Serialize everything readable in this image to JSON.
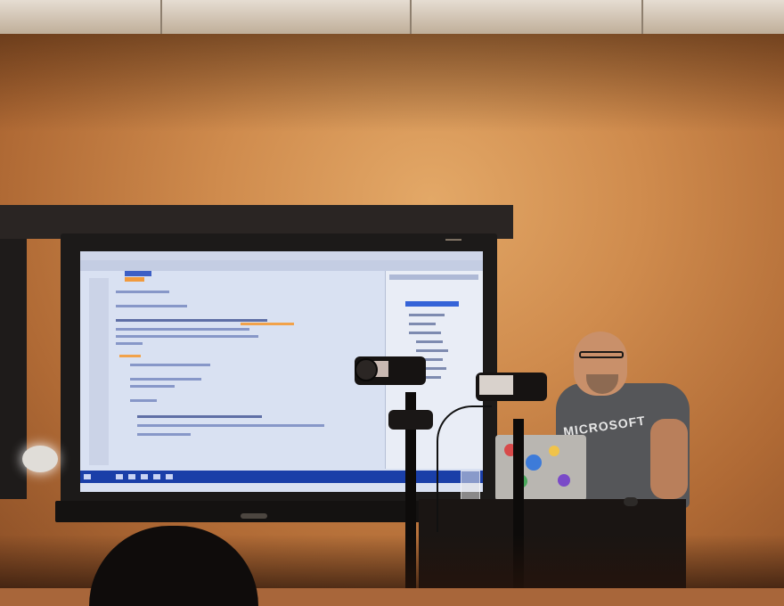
{
  "scene": {
    "description_type": "photo",
    "presenter_shirt_text": "MICROSOFT"
  },
  "colors": {
    "wall": "#cf8b4d",
    "screen_bg": "#d9e1f2",
    "taskbar": "#1a3fa8",
    "highlight_orange": "#f2a24a",
    "selection_blue": "#3563d8"
  },
  "icons": {
    "camera": "video-camera-icon",
    "tripod": "tripod-icon",
    "laptop": "laptop-icon"
  }
}
